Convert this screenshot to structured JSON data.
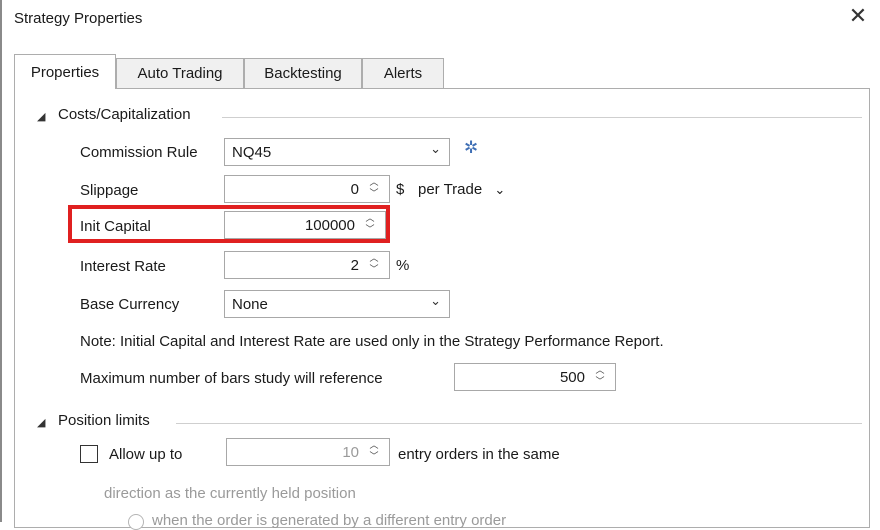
{
  "window": {
    "title": "Strategy Properties",
    "close_icon": "close-icon"
  },
  "tabs": [
    {
      "label": "Properties",
      "active": true
    },
    {
      "label": "Auto Trading",
      "active": false
    },
    {
      "label": "Backtesting",
      "active": false
    },
    {
      "label": "Alerts",
      "active": false
    }
  ],
  "costs": {
    "section_title": "Costs/Capitalization",
    "commission_rule": {
      "label": "Commission Rule",
      "value": "NQ45"
    },
    "slippage": {
      "label": "Slippage",
      "value": "0",
      "unit": "$",
      "mode": "per Trade"
    },
    "init_capital": {
      "label": "Init Capital",
      "value": "100000"
    },
    "interest_rate": {
      "label": "Interest Rate",
      "value": "2",
      "unit": "%"
    },
    "base_currency": {
      "label": "Base Currency",
      "value": "None"
    },
    "note": "Note: Initial Capital and Interest Rate are used only in the Strategy Performance Report.",
    "max_bars": {
      "label": "Maximum number of bars study will reference",
      "value": "500"
    }
  },
  "position_limits": {
    "section_title": "Position limits",
    "allow_up_to": {
      "label": "Allow up to",
      "checked": false,
      "value": "10",
      "suffix": "entry orders in the same"
    },
    "direction_text": "direction as the currently held position",
    "radio_text": "when the order is generated by a different entry order"
  },
  "colors": {
    "highlight": "#e02020",
    "gear": "#3f6fb5"
  }
}
